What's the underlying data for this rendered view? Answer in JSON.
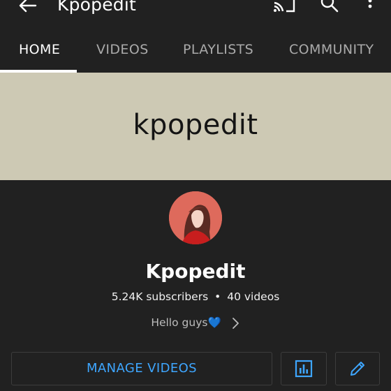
{
  "header": {
    "title": "Kpopedit",
    "icons": [
      "back-arrow-icon",
      "cast-icon",
      "search-icon",
      "more-vert-icon"
    ]
  },
  "tabs": [
    {
      "label": "HOME",
      "active": true
    },
    {
      "label": "VIDEOS",
      "active": false
    },
    {
      "label": "PLAYLISTS",
      "active": false
    },
    {
      "label": "COMMUNITY",
      "active": false
    }
  ],
  "banner": {
    "text": "kpopedit",
    "color": "#cdc9b4"
  },
  "channel": {
    "name": "Kpopedit",
    "subscribers": "5.24K subscribers",
    "separator": "•",
    "videos": "40 videos",
    "description": "Hello guys💙"
  },
  "actions": {
    "manage_videos": "MANAGE VIDEOS",
    "analytics_icon": "analytics-icon",
    "edit_icon": "edit-pencil-icon"
  },
  "colors": {
    "background": "#212121",
    "accent": "#3ea6ff",
    "tab_inactive": "#aaaaaa"
  }
}
